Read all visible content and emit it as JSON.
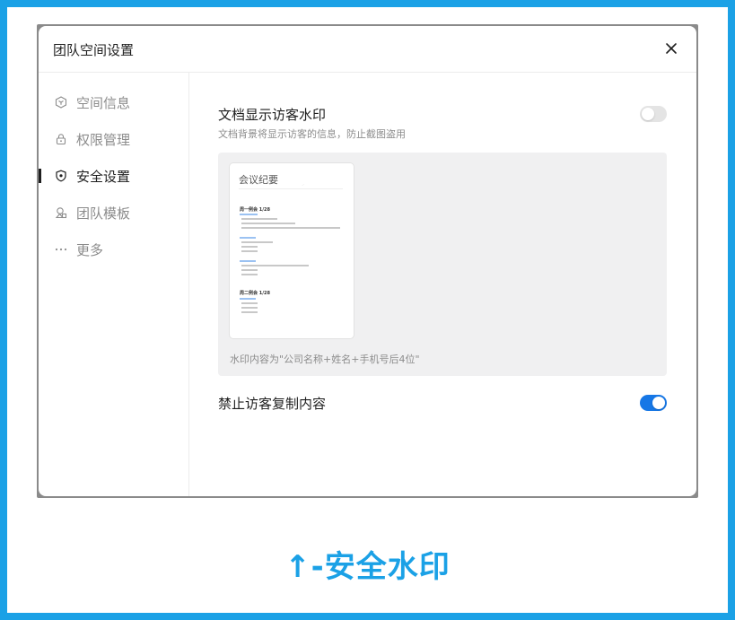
{
  "modal": {
    "title": "团队空间设置",
    "close_icon": "close-icon"
  },
  "sidebar": {
    "items": [
      {
        "label": "空间信息",
        "icon": "cube-icon",
        "active": false
      },
      {
        "label": "权限管理",
        "icon": "lock-icon",
        "active": false
      },
      {
        "label": "安全设置",
        "icon": "shield-icon",
        "active": true
      },
      {
        "label": "团队模板",
        "icon": "template-icon",
        "active": false
      },
      {
        "label": "更多",
        "icon": "more-icon",
        "active": false
      }
    ]
  },
  "settings": {
    "watermark": {
      "title": "文档显示访客水印",
      "desc": "文档背景将显示访客的信息，防止截图盗用",
      "enabled": false,
      "preview": {
        "doc_title": "会议纪要",
        "week1": "周一例会 1/28",
        "week2": "周二例会 1/28",
        "caption": "水印内容为\"公司名称+姓名+手机号后4位\""
      }
    },
    "copy_protect": {
      "title": "禁止访客复制内容",
      "enabled": true
    }
  },
  "footer_caption": "↑-安全水印",
  "colors": {
    "accent": "#1ba1e6",
    "toggle_on": "#1677e6",
    "toggle_off": "#e4e4e4"
  }
}
